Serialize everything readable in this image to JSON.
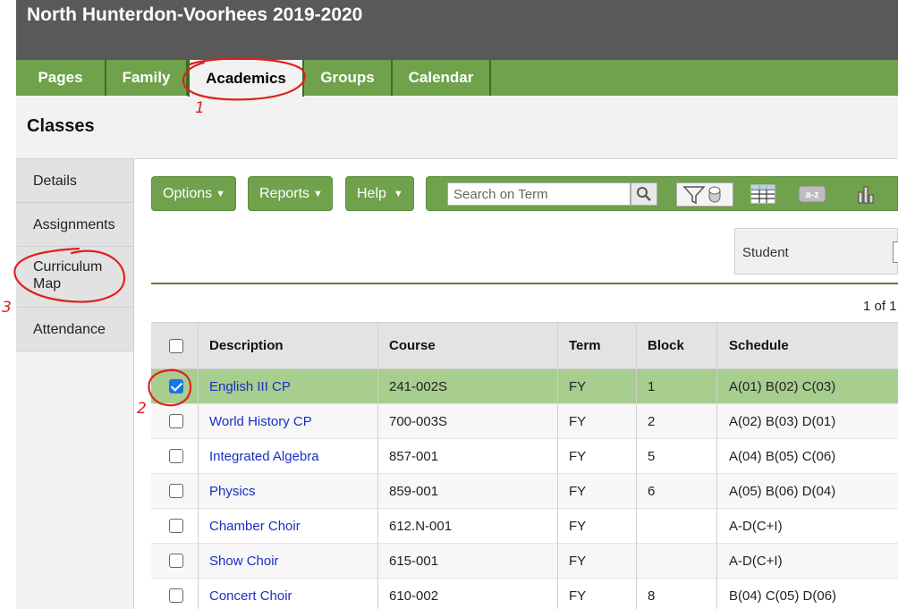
{
  "header": {
    "school_title": "North Hunterdon-Voorhees 2019-2020"
  },
  "top_tabs": [
    {
      "label": "Pages",
      "active": false
    },
    {
      "label": "Family",
      "active": false
    },
    {
      "label": "Academics",
      "active": true
    },
    {
      "label": "Groups",
      "active": false
    },
    {
      "label": "Calendar",
      "active": false
    }
  ],
  "page_title": "Classes",
  "side_nav": [
    {
      "label": "Details"
    },
    {
      "label": "Assignments"
    },
    {
      "label": "Curriculum\nMap"
    },
    {
      "label": "Attendance"
    }
  ],
  "toolbar": {
    "options_label": "Options",
    "reports_label": "Reports",
    "help_label": "Help",
    "search_placeholder": "Search on Term",
    "icons": [
      "search-icon",
      "filter-icon",
      "grid-view-icon",
      "sort-az-icon",
      "chart-icon"
    ]
  },
  "filter": {
    "label": "Student"
  },
  "pager": {
    "text": "1 of 1"
  },
  "table": {
    "columns": [
      "Description",
      "Course",
      "Term",
      "Block",
      "Schedule"
    ],
    "rows": [
      {
        "description": "English III CP",
        "course": "241-002S",
        "term": "FY",
        "block": "1",
        "schedule": "A(01) B(02) C(03)",
        "selected": true
      },
      {
        "description": "World History CP",
        "course": "700-003S",
        "term": "FY",
        "block": "2",
        "schedule": "A(02) B(03) D(01)",
        "selected": false
      },
      {
        "description": "Integrated Algebra",
        "course": "857-001",
        "term": "FY",
        "block": "5",
        "schedule": "A(04) B(05) C(06)",
        "selected": false
      },
      {
        "description": "Physics",
        "course": "859-001",
        "term": "FY",
        "block": "6",
        "schedule": "A(05) B(06) D(04)",
        "selected": false
      },
      {
        "description": "Chamber Choir",
        "course": "612.N-001",
        "term": "FY",
        "block": "",
        "schedule": "A-D(C+I)",
        "selected": false
      },
      {
        "description": "Show Choir",
        "course": "615-001",
        "term": "FY",
        "block": "",
        "schedule": "A-D(C+I)",
        "selected": false
      },
      {
        "description": "Concert Choir",
        "course": "610-002",
        "term": "FY",
        "block": "8",
        "schedule": "B(04) C(05) D(06)",
        "selected": false
      }
    ]
  },
  "annotations": {
    "marks": [
      "1",
      "2",
      "3"
    ],
    "color": "#e02020"
  },
  "colors": {
    "header_bg": "#595959",
    "nav_green": "#6fa24a",
    "selected_row": "#a7cd8f",
    "link_blue": "#1a2fbf"
  }
}
